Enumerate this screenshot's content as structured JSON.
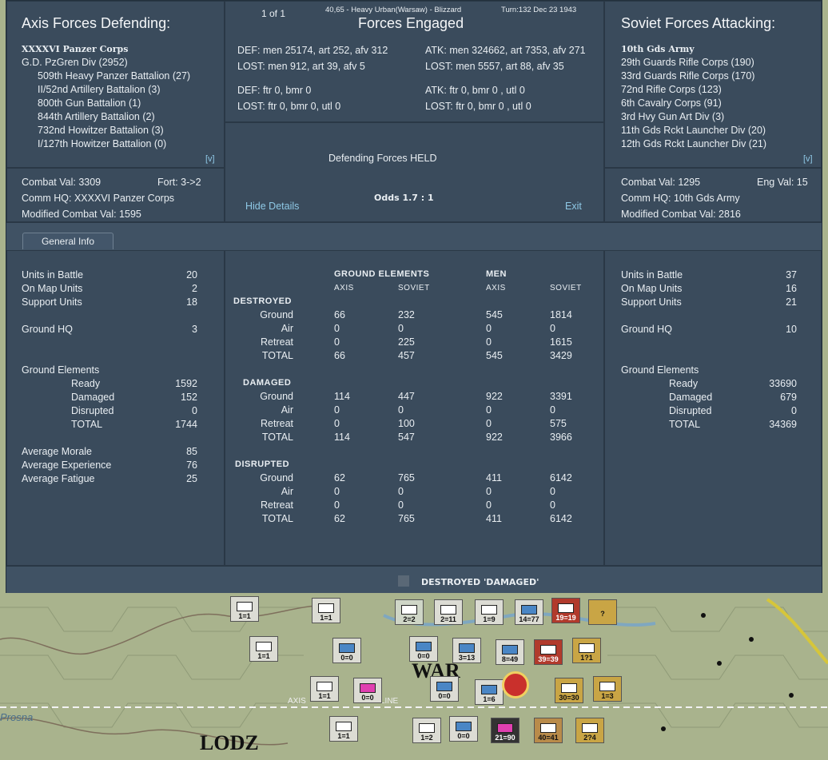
{
  "top_info": {
    "page": "1 of 1",
    "location": "40,65 - Heavy Urban(Warsaw) - Blizzard",
    "turn": "Turn:132  Dec 23 1943"
  },
  "axis": {
    "title": "Axis Forces Defending:",
    "units": [
      "XXXXVI Panzer Corps",
      "G.D. PzGren Div (2952)",
      "509th Heavy Panzer Battalion (27)",
      "II/52nd Artillery Battalion (3)",
      "800th Gun Battalion (1)",
      "844th Artillery Battalion (2)",
      "732nd Howitzer Battalion (3)",
      "I/127th Howitzer Battalion (0)"
    ],
    "expand": "[v]",
    "combat_val": "Combat Val: 3309",
    "fort": "Fort: 3->2",
    "comm_hq": "Comm HQ: XXXXVI Panzer Corps",
    "modified": "Modified Combat Val: 1595"
  },
  "soviet": {
    "title": "Soviet Forces Attacking:",
    "units": [
      "10th Gds Army",
      "29th Guards Rifle Corps (190)",
      "33rd Guards Rifle Corps (170)",
      "72nd Rifle Corps (123)",
      "6th Cavalry Corps (91)",
      "3rd Hvy Gun Art Div (3)",
      "11th Gds Rckt Launcher Div (20)",
      "12th Gds Rckt Launcher Div (21)"
    ],
    "expand": "[v]",
    "combat_val": "Combat Val: 1295",
    "eng_val": "Eng Val: 15",
    "comm_hq": "Comm HQ: 10th Gds Army",
    "modified": "Modified Combat Val: 2816"
  },
  "engaged": {
    "title": "Forces Engaged",
    "def1": "DEF: men 25174, art 252, afv 312",
    "lost1": "LOST: men 912, art 39, afv 5",
    "atk1": "ATK: men 324662, art 7353, afv 271",
    "alost1": "LOST: men 5557, art 88, afv 35",
    "def2": "DEF: ftr 0, bmr 0",
    "lost2": "LOST: ftr 0, bmr 0, utl 0",
    "atk2": "ATK: ftr 0, bmr 0 , utl 0",
    "alost2": "LOST: ftr 0, bmr 0 , utl 0",
    "result": "Defending Forces HELD",
    "odds": "Odds 1.7 : 1",
    "hide": "Hide Details",
    "exit": "Exit"
  },
  "tab": "General Info",
  "axis_stats": [
    {
      "label": "Units in Battle",
      "value": "20"
    },
    {
      "label": "On Map Units",
      "value": "2"
    },
    {
      "label": "Support Units",
      "value": "18"
    },
    {
      "label": "Ground HQ",
      "value": "3"
    },
    {
      "label": "Ground Elements",
      "value": ""
    },
    {
      "label": "Ready",
      "value": "1592"
    },
    {
      "label": "Damaged",
      "value": "152"
    },
    {
      "label": "Disrupted",
      "value": "0"
    },
    {
      "label": "TOTAL",
      "value": "1744"
    },
    {
      "label": "Average Morale",
      "value": "85"
    },
    {
      "label": "Average Experience",
      "value": "76"
    },
    {
      "label": "Average Fatigue",
      "value": "25"
    }
  ],
  "soviet_stats": [
    {
      "label": "Units in Battle",
      "value": "37"
    },
    {
      "label": "On Map Units",
      "value": "16"
    },
    {
      "label": "Support Units",
      "value": "21"
    },
    {
      "label": "Ground HQ",
      "value": "10"
    },
    {
      "label": "Ground Elements",
      "value": ""
    },
    {
      "label": "Ready",
      "value": "33690"
    },
    {
      "label": "Damaged",
      "value": "679"
    },
    {
      "label": "Disrupted",
      "value": "0"
    },
    {
      "label": "TOTAL",
      "value": "34369"
    }
  ],
  "losses": {
    "h_ground": "GROUND ELEMENTS",
    "h_men": "MEN",
    "axis": "AXIS",
    "soviet": "SOVIET",
    "sections": [
      {
        "name": "DESTROYED",
        "rows": [
          [
            "Ground",
            "66",
            "232",
            "545",
            "1814"
          ],
          [
            "Air",
            "0",
            "0",
            "0",
            "0"
          ],
          [
            "Retreat",
            "0",
            "225",
            "0",
            "1615"
          ],
          [
            "TOTAL",
            "66",
            "457",
            "545",
            "3429"
          ]
        ]
      },
      {
        "name": "DAMAGED",
        "rows": [
          [
            "Ground",
            "114",
            "447",
            "922",
            "3391"
          ],
          [
            "Air",
            "0",
            "0",
            "0",
            "0"
          ],
          [
            "Retreat",
            "0",
            "100",
            "0",
            "575"
          ],
          [
            "TOTAL",
            "114",
            "547",
            "922",
            "3966"
          ]
        ]
      },
      {
        "name": "DISRUPTED",
        "rows": [
          [
            "Ground",
            "62",
            "765",
            "411",
            "6142"
          ],
          [
            "Air",
            "0",
            "0",
            "0",
            "0"
          ],
          [
            "Retreat",
            "0",
            "0",
            "0",
            "0"
          ],
          [
            "TOTAL",
            "62",
            "765",
            "411",
            "6142"
          ]
        ]
      }
    ]
  },
  "footer": "DESTROYED 'DAMAGED'",
  "map": {
    "labels": [
      "WAR",
      "LODZ",
      "AXIS",
      "LINE",
      "Prosna"
    ],
    "units": [
      "1=1",
      "1=1",
      "2=2",
      "2=11",
      "1=9",
      "14=77",
      "19=19",
      "?",
      "1=1",
      "0=0",
      "0=0",
      "3=13",
      "8=49",
      "39=39",
      "1?1",
      "1=1",
      "0=0",
      "0=0",
      "1=6",
      "30=30",
      "1=3",
      "1=1",
      "1=2",
      "0=0",
      "21=90",
      "40=41",
      "2?4"
    ]
  }
}
